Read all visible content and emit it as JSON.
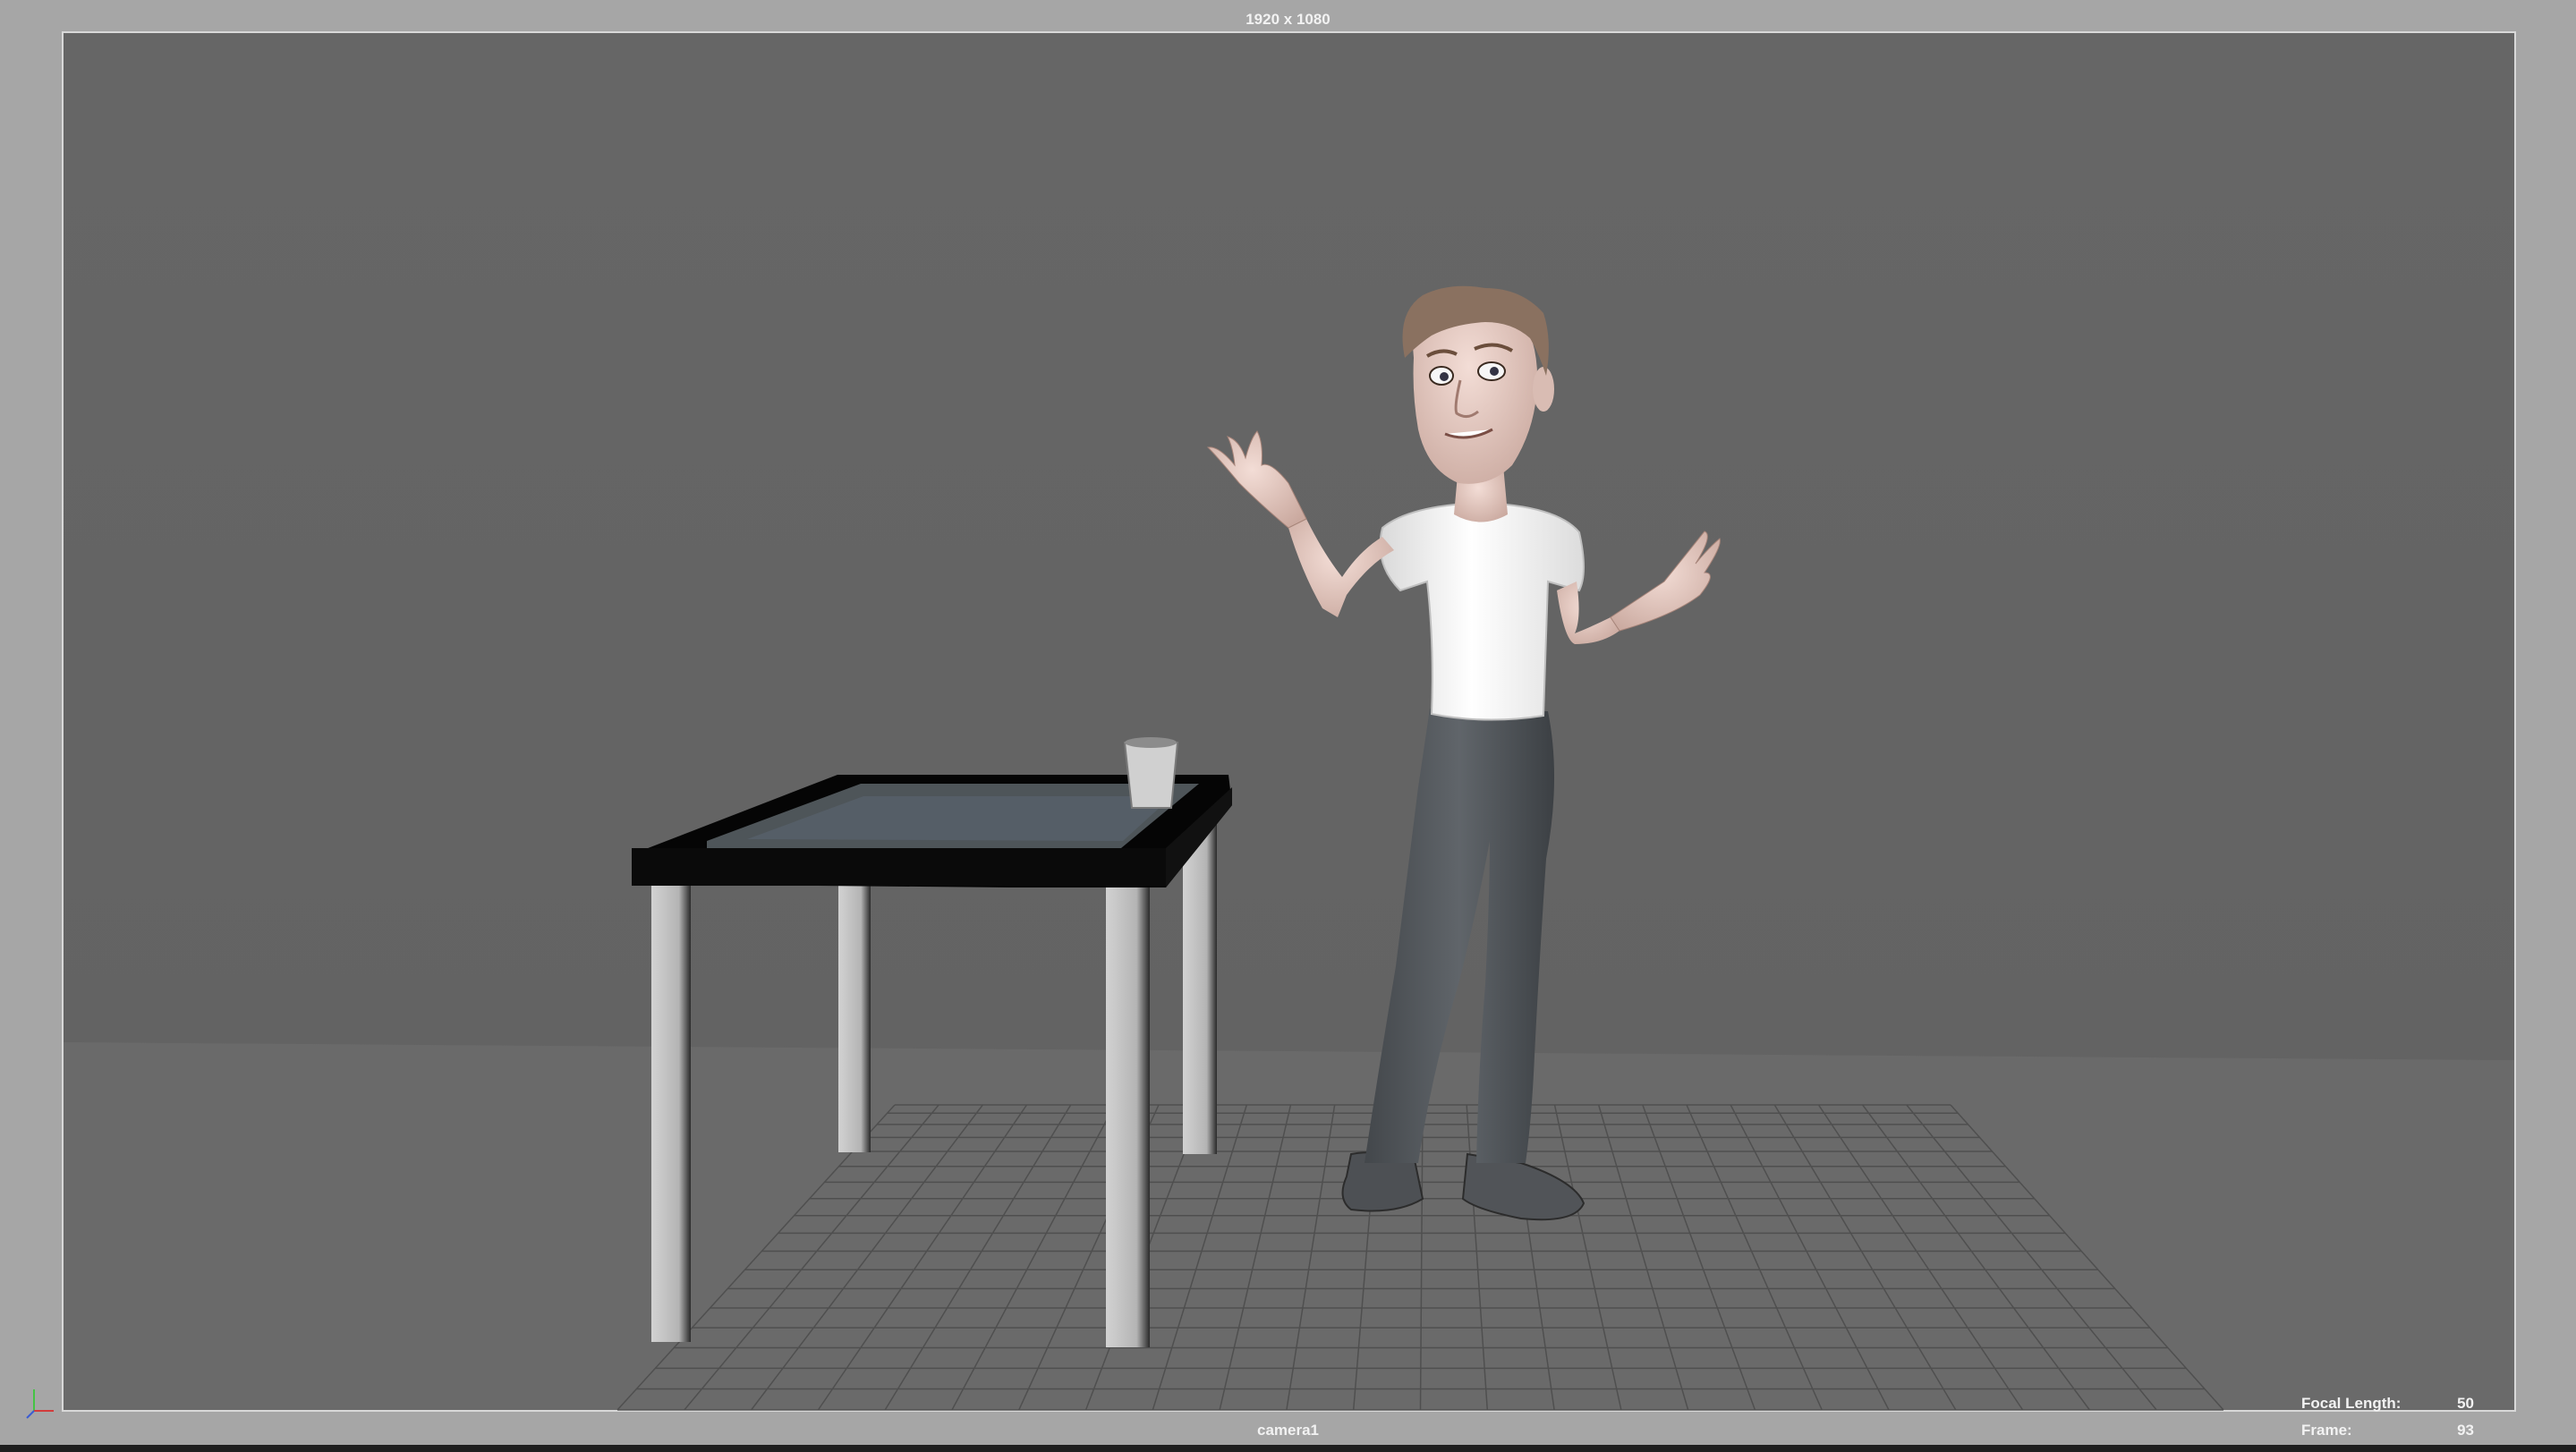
{
  "viewport": {
    "resolution_label": "1920 x 1080",
    "camera_name": "camera1",
    "hud": {
      "focal_length_label": "Focal Length:",
      "focal_length_value": "50",
      "frame_label": "Frame:",
      "frame_value": "93"
    },
    "colors": {
      "outer_frame": "#a6a6a6",
      "background": "#666666",
      "floor": "#6b6b6b",
      "grid": "#4a4a4a",
      "table_top": "#050505",
      "table_legs": "#bdbdbd",
      "glass": "#4e5559",
      "shirt": "#f0f0f0",
      "pants": "#55595d",
      "skin": "#e8cfc8",
      "hair": "#8a7160"
    }
  },
  "axis_gizmo": {
    "icon": "axis-gizmo-icon"
  }
}
